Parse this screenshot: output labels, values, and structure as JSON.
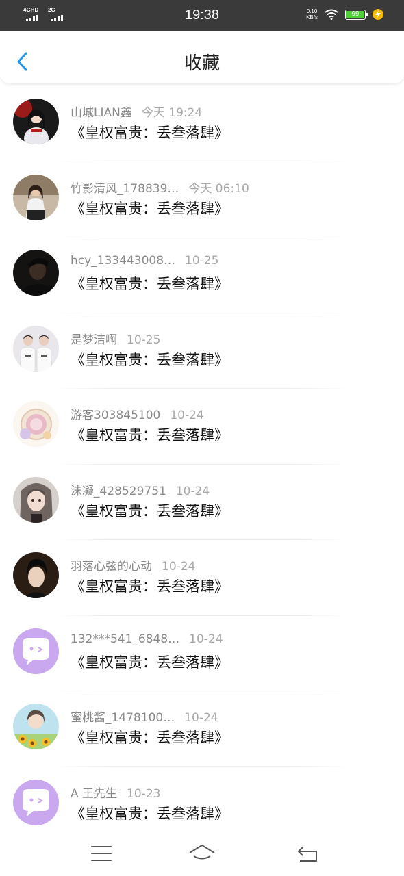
{
  "status_bar": {
    "time": "19:38",
    "signal1": "4GHD",
    "signal2": "2G",
    "net_speed": "0.10",
    "net_unit": "KB/s",
    "battery": "99"
  },
  "header": {
    "title": "收藏"
  },
  "items": [
    {
      "name": "山城LIAN鑫",
      "date": "今天 19:24",
      "title": "《皇权富贵：丢叁落肆》"
    },
    {
      "name": "竹影清风_178839…",
      "date": "今天 06:10",
      "title": "《皇权富贵：丢叁落肆》"
    },
    {
      "name": "hcy_133443008…",
      "date": "10-25",
      "title": "《皇权富贵：丢叁落肆》"
    },
    {
      "name": "是梦洁啊",
      "date": "10-25",
      "title": "《皇权富贵：丢叁落肆》"
    },
    {
      "name": "游客303845100",
      "date": "10-24",
      "title": "《皇权富贵：丢叁落肆》"
    },
    {
      "name": "沫凝_428529751",
      "date": "10-24",
      "title": "《皇权富贵：丢叁落肆》"
    },
    {
      "name": "羽落心弦的心动",
      "date": "10-24",
      "title": "《皇权富贵：丢叁落肆》"
    },
    {
      "name": "132***541_6848…",
      "date": "10-24",
      "title": "《皇权富贵：丢叁落肆》"
    },
    {
      "name": "蜜桃酱_1478100…",
      "date": "10-24",
      "title": "《皇权富贵：丢叁落肆》"
    },
    {
      "name": "A 王先生",
      "date": "10-23",
      "title": "《皇权富贵：丢叁落肆》"
    }
  ],
  "colors": {
    "accent": "#2196f3",
    "default_avatar": "#c9a8ef",
    "battery_fill": "#4cd137"
  },
  "icons": {
    "back": "back-arrow-icon",
    "menu": "menu-icon",
    "home": "home-icon",
    "return": "return-icon"
  }
}
